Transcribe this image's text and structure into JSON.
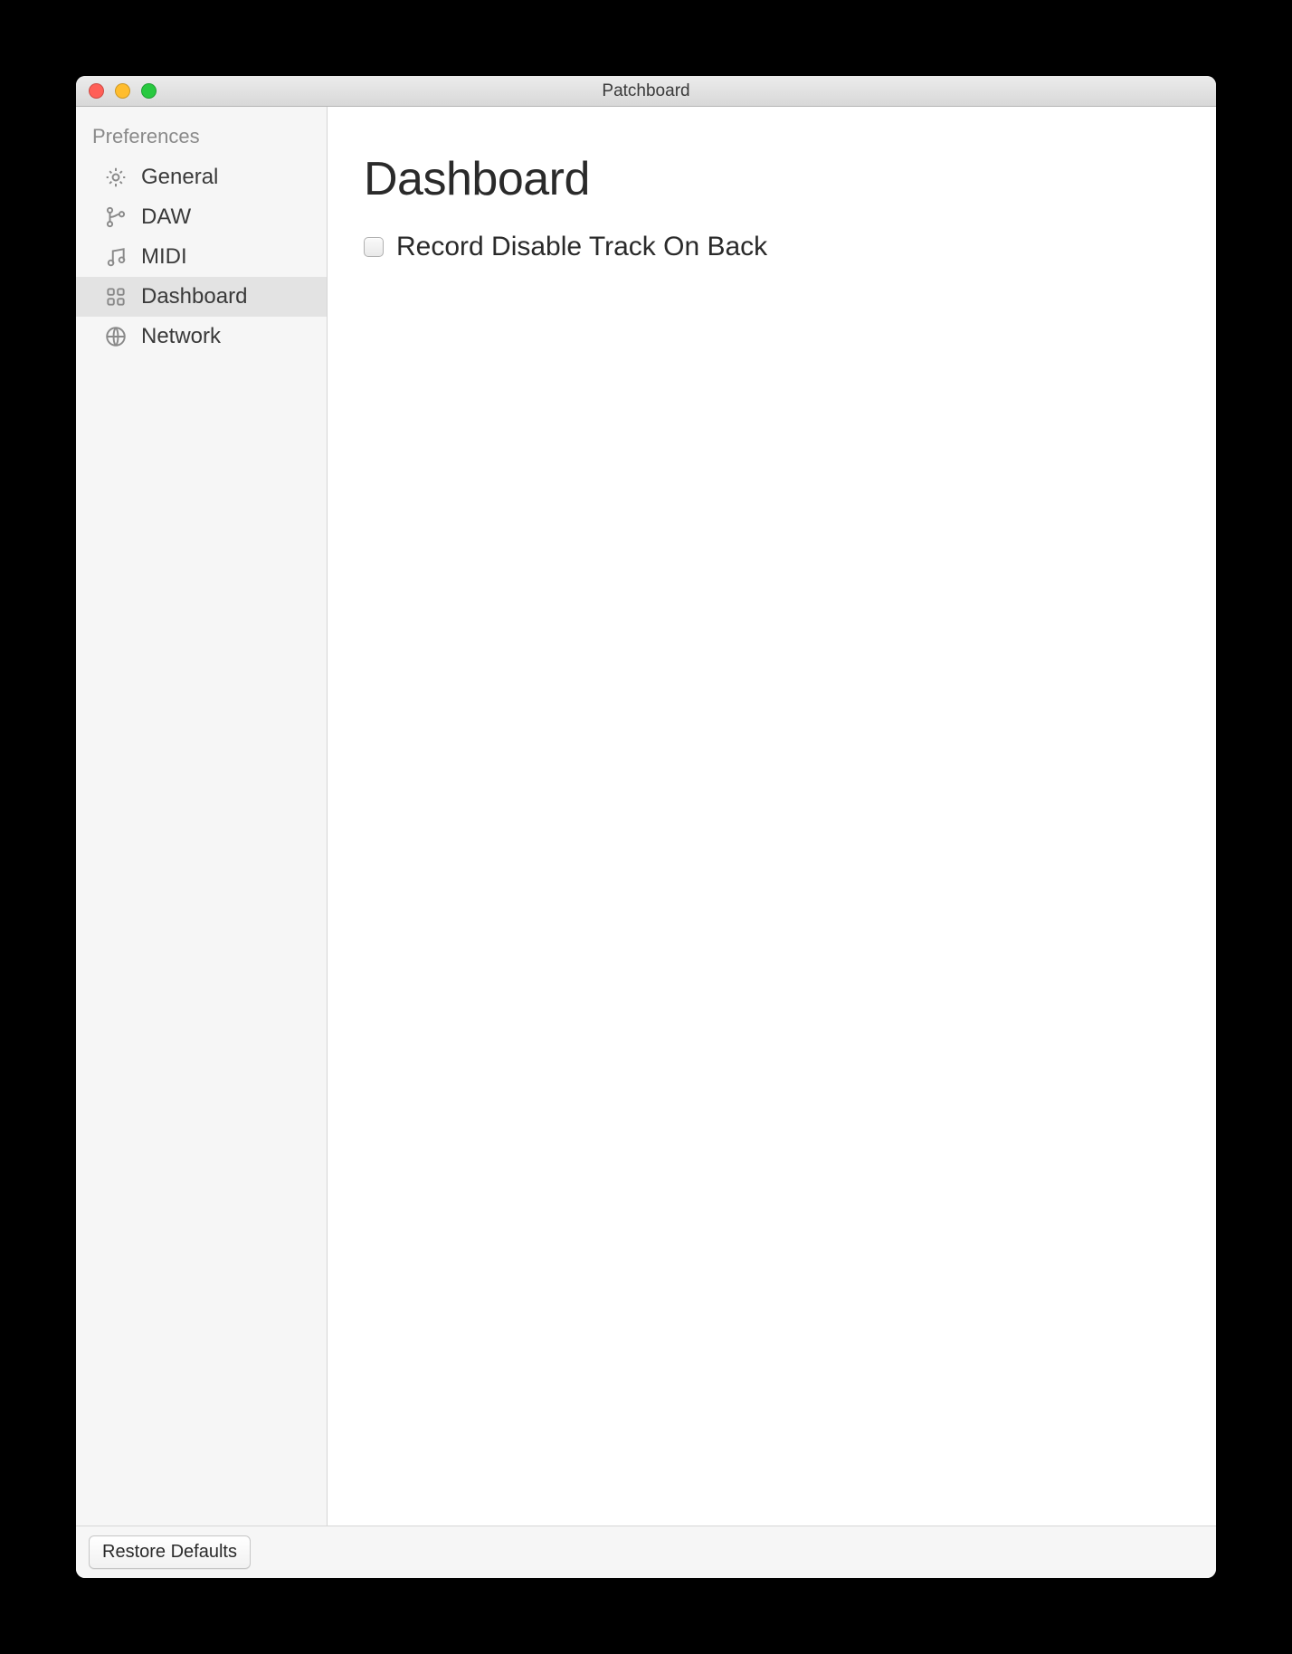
{
  "window": {
    "title": "Patchboard"
  },
  "sidebar": {
    "header": "Preferences",
    "items": [
      {
        "label": "General",
        "icon": "gear-icon",
        "selected": false
      },
      {
        "label": "DAW",
        "icon": "branch-icon",
        "selected": false
      },
      {
        "label": "MIDI",
        "icon": "music-icon",
        "selected": false
      },
      {
        "label": "Dashboard",
        "icon": "grid-icon",
        "selected": true
      },
      {
        "label": "Network",
        "icon": "globe-icon",
        "selected": false
      }
    ]
  },
  "main": {
    "heading": "Dashboard",
    "options": [
      {
        "label": "Record Disable Track On Back",
        "checked": false
      }
    ]
  },
  "footer": {
    "restore_label": "Restore Defaults"
  }
}
